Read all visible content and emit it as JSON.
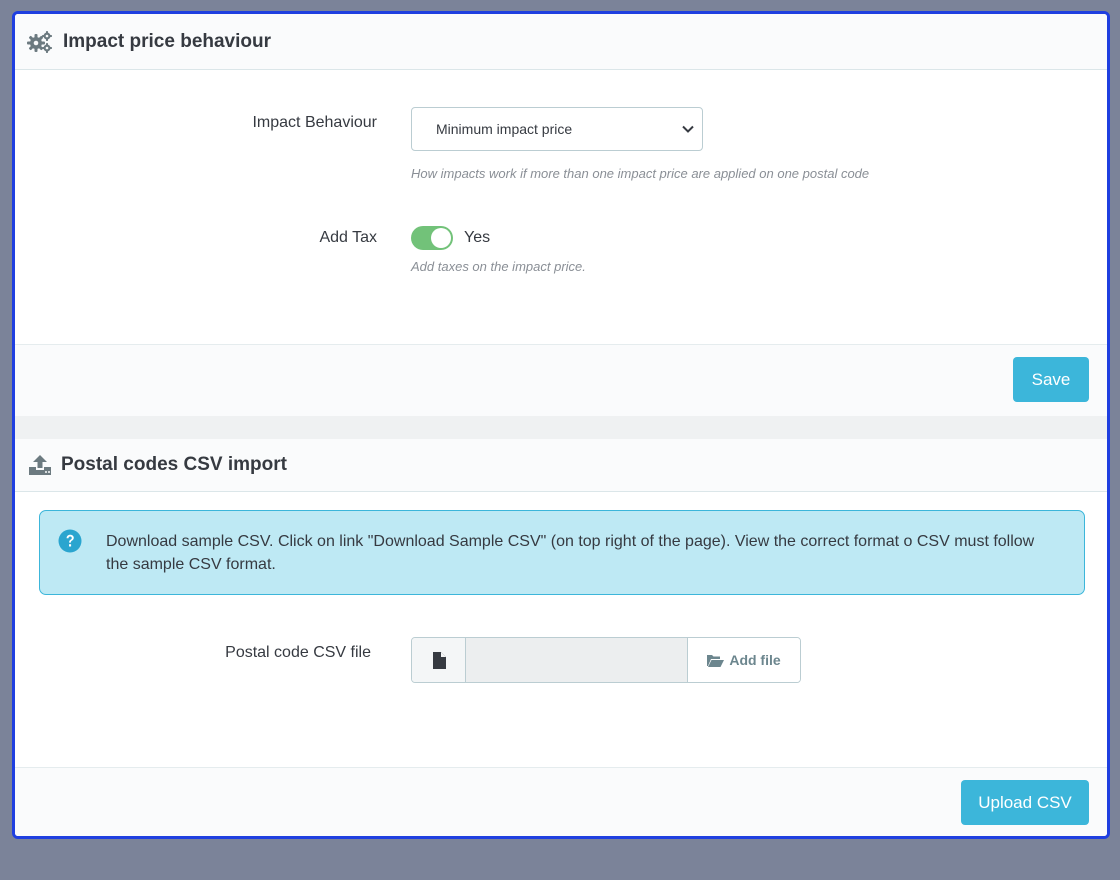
{
  "impact_panel": {
    "title": "Impact price behaviour",
    "behaviour_label": "Impact Behaviour",
    "behaviour_value": "Minimum impact price",
    "behaviour_help": "How impacts work if more than one impact price are applied on one postal code",
    "tax_label": "Add Tax",
    "tax_enabled": true,
    "tax_state_label": "Yes",
    "tax_help": "Add taxes on the impact price.",
    "save_label": "Save"
  },
  "csv_panel": {
    "title": "Postal codes CSV import",
    "info_text": "Download sample CSV. Click on link \"Download Sample CSV\" (on top right of the page). View the correct format o CSV must follow the sample CSV format.",
    "file_label": "Postal code CSV file",
    "add_file_label": "Add file",
    "upload_label": "Upload CSV"
  },
  "colors": {
    "accent": "#3cb6da",
    "toggle_on": "#72c279",
    "info_bg": "#bee9f4",
    "frame_border": "#1f3fe0"
  },
  "icons": {
    "impact_header": "cogs-icon",
    "csv_header": "upload-icon",
    "info": "question-circle-icon",
    "file": "file-icon",
    "add_file": "folder-open-icon"
  }
}
